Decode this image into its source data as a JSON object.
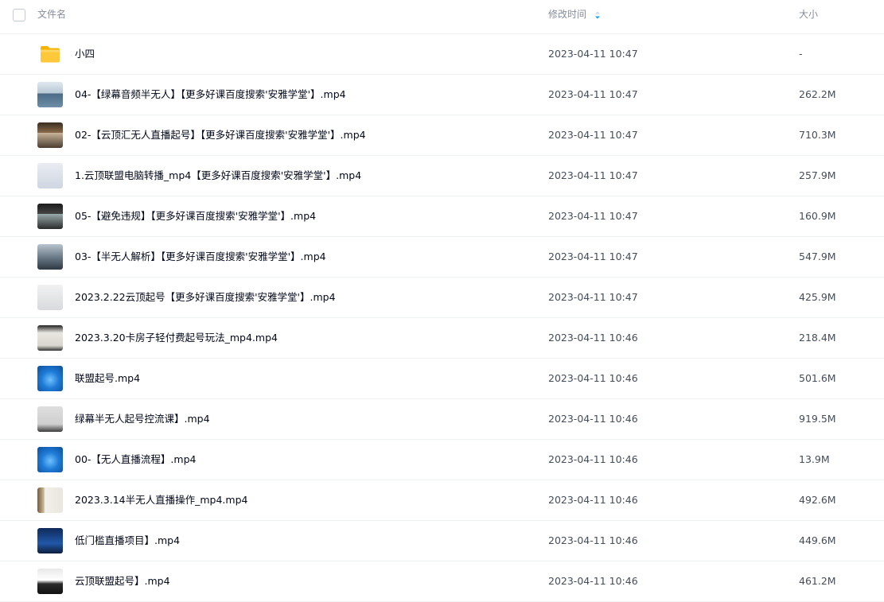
{
  "header": {
    "name_label": "文件名",
    "mtime_label": "修改时间",
    "size_label": "大小",
    "sort_color": "#06a7ff"
  },
  "files": [
    {
      "name": "小四",
      "date": "2023-04-11 10:47",
      "size": "-",
      "icon": "folder-icon"
    },
    {
      "name": "04-【绿幕音频半无人】【更多好课百度搜索'安雅学堂'】.mp4",
      "date": "2023-04-11 10:47",
      "size": "262.2M",
      "icon": "video-thumbnail"
    },
    {
      "name": "02-【云顶汇无人直播起号】【更多好课百度搜索'安雅学堂'】.mp4",
      "date": "2023-04-11 10:47",
      "size": "710.3M",
      "icon": "video-thumbnail"
    },
    {
      "name": "1.云顶联盟电脑转播_mp4【更多好课百度搜索'安雅学堂'】.mp4",
      "date": "2023-04-11 10:47",
      "size": "257.9M",
      "icon": "video-thumbnail"
    },
    {
      "name": "05-【避免违规】【更多好课百度搜索'安雅学堂'】.mp4",
      "date": "2023-04-11 10:47",
      "size": "160.9M",
      "icon": "video-thumbnail"
    },
    {
      "name": "03-【半无人解析】【更多好课百度搜索'安雅学堂'】.mp4",
      "date": "2023-04-11 10:47",
      "size": "547.9M",
      "icon": "video-thumbnail"
    },
    {
      "name": "2023.2.22云顶起号【更多好课百度搜索'安雅学堂'】.mp4",
      "date": "2023-04-11 10:47",
      "size": "425.9M",
      "icon": "video-thumbnail"
    },
    {
      "name": "2023.3.20卡房子轻付费起号玩法_mp4.mp4",
      "date": "2023-04-11 10:46",
      "size": "218.4M",
      "icon": "video-thumbnail"
    },
    {
      "name": "联盟起号.mp4",
      "date": "2023-04-11 10:46",
      "size": "501.6M",
      "icon": "video-thumbnail"
    },
    {
      "name": "绿幕半无人起号控流课】.mp4",
      "date": "2023-04-11 10:46",
      "size": "919.5M",
      "icon": "video-thumbnail"
    },
    {
      "name": "00-【无人直播流程】.mp4",
      "date": "2023-04-11 10:46",
      "size": "13.9M",
      "icon": "video-thumbnail"
    },
    {
      "name": "2023.3.14半无人直播操作_mp4.mp4",
      "date": "2023-04-11 10:46",
      "size": "492.6M",
      "icon": "video-thumbnail"
    },
    {
      "name": "低门槛直播项目】.mp4",
      "date": "2023-04-11 10:46",
      "size": "449.6M",
      "icon": "video-thumbnail"
    },
    {
      "name": "云顶联盟起号】.mp4",
      "date": "2023-04-11 10:46",
      "size": "461.2M",
      "icon": "video-thumbnail"
    }
  ]
}
